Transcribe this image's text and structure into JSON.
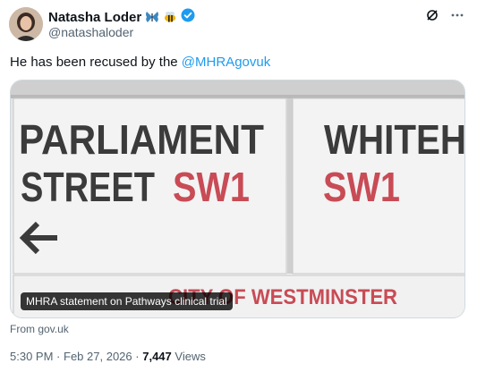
{
  "author": {
    "name": "Natasha Loder",
    "handle": "@natashaloder",
    "badges": [
      "butterfly-icon",
      "bee-icon",
      "verified-icon"
    ]
  },
  "tweet": {
    "text_prefix": "He has been recused by the ",
    "mention": "@MHRAgovuk"
  },
  "card": {
    "image_text": {
      "line1": "PARLIAMENT",
      "line2_a": "STREET",
      "line2_b": "SW1",
      "right_line1": "WHITEH",
      "right_line2": "SW1",
      "bottom": "CITY OF WESTMINSTER"
    },
    "title": "MHRA statement on Pathways clinical trial",
    "source": "From gov.uk"
  },
  "meta": {
    "time": "5:30 PM",
    "date": "Feb 27, 2026",
    "views_count": "7,447",
    "views_label": "Views"
  },
  "colors": {
    "accent": "#1d9bf0",
    "sign_red": "#c84b55",
    "sign_dark": "#3b3b3b"
  }
}
